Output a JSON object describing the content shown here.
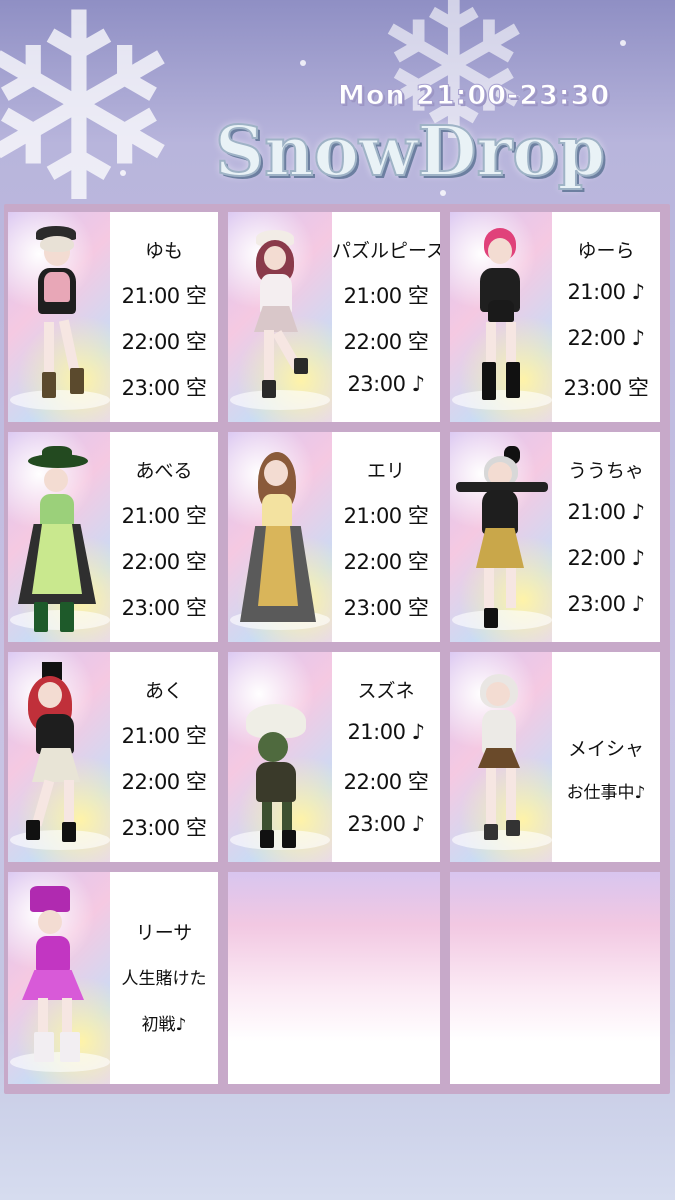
{
  "header": {
    "time": "Mon 21:00-23:30",
    "title": "SnowDrop"
  },
  "cards": [
    {
      "name": "ゆも",
      "slots": [
        "21:00 空",
        "22:00 空",
        "23:00 空"
      ]
    },
    {
      "name": "パズルピース",
      "slots": [
        "21:00 空",
        "22:00 空",
        "23:00 ♪"
      ]
    },
    {
      "name": "ゆーら",
      "slots": [
        "21:00 ♪",
        "22:00 ♪",
        "23:00 空"
      ]
    },
    {
      "name": "あべる",
      "slots": [
        "21:00 空",
        "22:00 空",
        "23:00 空"
      ]
    },
    {
      "name": "エリ",
      "slots": [
        "21:00 空",
        "22:00 空",
        "23:00 空"
      ]
    },
    {
      "name": "ううちゃ",
      "slots": [
        "21:00 ♪",
        "22:00 ♪",
        "23:00 ♪"
      ]
    },
    {
      "name": "あく",
      "slots": [
        "21:00 空",
        "22:00 空",
        "23:00 空"
      ]
    },
    {
      "name": "スズネ",
      "slots": [
        "21:00 ♪",
        "22:00 空",
        "23:00 ♪"
      ]
    },
    {
      "name": "メイシャ",
      "note": "お仕事中♪"
    },
    {
      "name": "リーサ",
      "note_lines": [
        "人生賭けた",
        "初戦♪"
      ]
    }
  ],
  "colors": {
    "board": "#c7a9c9",
    "background_top": "#8f8fc4",
    "background_bottom": "#d6dcef"
  },
  "icons": [
    "snowflake-icon",
    "music-note-icon"
  ]
}
